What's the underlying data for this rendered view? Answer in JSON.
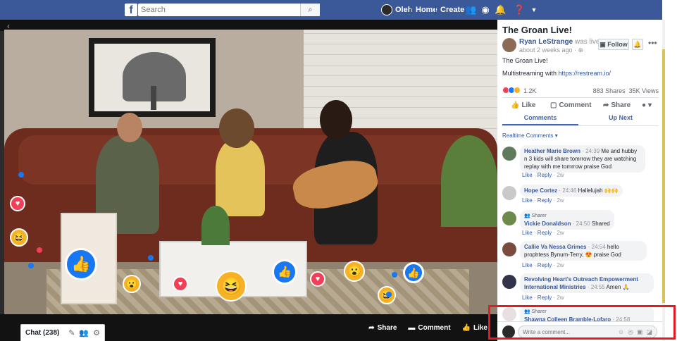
{
  "topbar": {
    "logo": "f",
    "search_placeholder": "Search",
    "search_icon": "search-icon",
    "user_name": "Oleh",
    "home": "Home",
    "create": "Create",
    "icons": [
      "friends-icon",
      "messenger-icon",
      "bell-icon",
      "help-icon",
      "caret-down-icon"
    ]
  },
  "video": {
    "actions": {
      "share": "Share",
      "comment": "Comment",
      "like": "Like"
    }
  },
  "chatbar": {
    "label": "Chat (238)"
  },
  "post": {
    "title": "The Groan Live!",
    "author": "Ryan LeStrange",
    "author_suffix": "was live.",
    "time": "about 2 weeks ago · ",
    "follow": "Follow",
    "description": "The Groan Live!",
    "multistream": "Multistreaming with ",
    "link": "https://restream.io/",
    "reaction_count": "1.2K",
    "shares": "883 Shares",
    "views": "35K Views",
    "actions": {
      "like": "Like",
      "comment": "Comment",
      "share": "Share"
    },
    "tabs": {
      "comments": "Comments",
      "up_next": "Up Next"
    },
    "realtime": "Realtime Comments ▾"
  },
  "comments": [
    {
      "name": "Heather Marie Brown",
      "time": "· 24:39",
      "text": "Me and hubby n 3 kids will share tomrrow they are watching replay with me tomrrow praise God",
      "like": "Like",
      "reply": "Reply",
      "age": "2w"
    },
    {
      "name": "Hope Cortez",
      "time": "· 24:46",
      "text": "Hallelujah 🙌🙌",
      "like": "Like",
      "reply": "Reply",
      "age": "2w"
    },
    {
      "sharer": "Sharer",
      "name": "Vickie Donaldson",
      "time": "· 24:50",
      "text": "Shared",
      "like": "Like",
      "reply": "Reply",
      "age": "2w"
    },
    {
      "name": "Callie Va Nessa Grimes",
      "time": "· 24:54",
      "text": "hello prophtess Bynum-Terry, 😍 praise God",
      "like": "Like",
      "reply": "Reply",
      "age": "2w"
    },
    {
      "name": "Revolving Heart's Outreach Empowerment International Ministries",
      "time": "· 24:55",
      "text": "Amen 🙏",
      "like": "Like",
      "reply": "Reply",
      "age": "2w"
    },
    {
      "sharer": "Sharer",
      "name": "Shawna Colleen Bramble-Lofaro",
      "time": "· 24:58"
    }
  ],
  "compose": {
    "placeholder": "Write a comment..."
  },
  "colors": {
    "facebook_blue": "#3b5998",
    "link_blue": "#365899",
    "highlight_red": "#e31b23"
  }
}
